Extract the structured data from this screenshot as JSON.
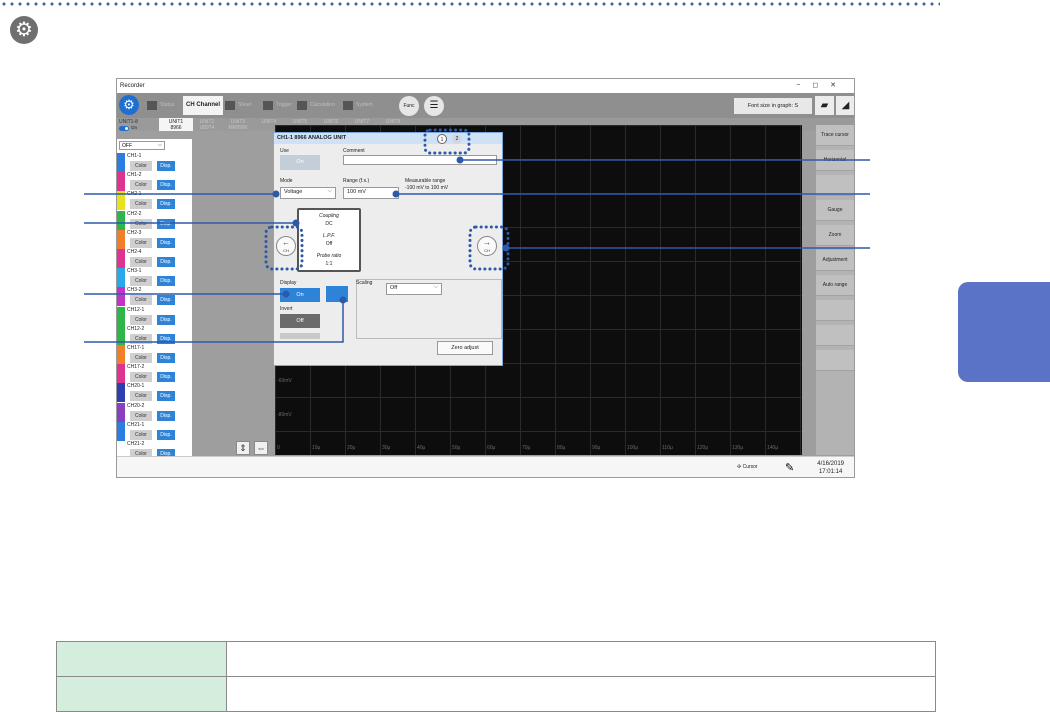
{
  "window": {
    "title": "Recorder",
    "controls": [
      "−",
      "◻",
      "✕"
    ]
  },
  "toolbar": {
    "items": [
      "Status",
      "Channel",
      "Sheet",
      "Trigger",
      "Calculation",
      "System"
    ],
    "channel_prefix": "CH",
    "func": "Func",
    "font_size": "Font size in graph: S"
  },
  "units": {
    "label": "UNIT1-8",
    "ch_label": "CH ALL",
    "toggle": "On",
    "tabs": [
      {
        "name": "UNIT1",
        "model": "8966"
      },
      {
        "name": "UNIT2",
        "model": "U8974"
      },
      {
        "name": "UNIT3",
        "model": "MR8990"
      },
      {
        "name": "UNIT4",
        "model": ""
      },
      {
        "name": "UNIT5",
        "model": ""
      },
      {
        "name": "UNIT6",
        "model": ""
      },
      {
        "name": "UNIT7",
        "model": ""
      },
      {
        "name": "UNIT8",
        "model": ""
      }
    ]
  },
  "channels": {
    "filter": "OFF",
    "color_label": "Color",
    "disp_label": "Disp.",
    "rows": [
      {
        "name": "CH1-1",
        "color": "#2b7de0"
      },
      {
        "name": "CH1-2",
        "color": "#e0338f"
      },
      {
        "name": "CH2-1",
        "color": "#e6e21c"
      },
      {
        "name": "CH2-2",
        "color": "#2fb54a"
      },
      {
        "name": "CH2-3",
        "color": "#f07f2a"
      },
      {
        "name": "CH2-4",
        "color": "#e0338f"
      },
      {
        "name": "CH3-1",
        "color": "#29a9e8"
      },
      {
        "name": "CH3-2",
        "color": "#c333c8"
      },
      {
        "name": "CH12-1",
        "color": "#2fb54a"
      },
      {
        "name": "CH12-2",
        "color": "#2fb54a"
      },
      {
        "name": "CH17-1",
        "color": "#f07f2a"
      },
      {
        "name": "CH17-2",
        "color": "#e0338f"
      },
      {
        "name": "CH20-1",
        "color": "#2b3fb0"
      },
      {
        "name": "CH20-2",
        "color": "#8840c0"
      },
      {
        "name": "CH21-1",
        "color": "#2b7de0"
      },
      {
        "name": "CH21-2",
        "color": "#ffffff"
      }
    ]
  },
  "graph": {
    "y_labels": [
      "-60mV",
      "-80mV"
    ],
    "x_labels": [
      "0",
      "10μ",
      "20μ",
      "30μ",
      "40μ",
      "50μ",
      "60μ",
      "70μ",
      "80μ",
      "90μ",
      "100μ",
      "110μ",
      "120μ",
      "130μ",
      "140μ"
    ]
  },
  "right_panel": [
    "Trace cursor",
    "Horizontal",
    "",
    "Gauge",
    "Zoom",
    "Adjustment",
    "Auto range",
    "",
    "",
    ""
  ],
  "status": {
    "cursor": "Cursor",
    "date": "4/16/2019",
    "time": "17:01:14"
  },
  "dialog": {
    "title": "CH1-1     8966 ANALOG UNIT",
    "pages": [
      "1",
      "2"
    ],
    "use_label": "Use",
    "use_value": "On",
    "comment_label": "Comment",
    "comment_value": "",
    "mode_label": "Mode",
    "mode_value": "Voltage",
    "range_label": "Range (f.s.)",
    "range_value": "100 mV",
    "meas_label": "Measurable range",
    "meas_value": "-100 mV to 100 mV",
    "coupling_label": "Coupling",
    "coupling_value": "DC",
    "lpf_label": "L.P.F.",
    "lpf_value": "Off",
    "probe_label": "Probe ratio",
    "probe_value": "1:1",
    "arrow_ch": "CH",
    "display_label": "Display",
    "display_value": "On",
    "invert_label": "Invert",
    "invert_value": "Off",
    "scaling_label": "Scaling",
    "scaling_value": "Off",
    "zero_adjust": "Zero adjust"
  },
  "callouts": [
    "1",
    "2"
  ],
  "legend": [
    {
      "key": "",
      "value": ""
    },
    {
      "key": "",
      "value": ""
    }
  ],
  "colors": {
    "accent": "#2d83d8",
    "dot_line": "#3a5fb0",
    "side_tab": "#5b73c6",
    "legend_key_bg": "#d4eddc"
  }
}
